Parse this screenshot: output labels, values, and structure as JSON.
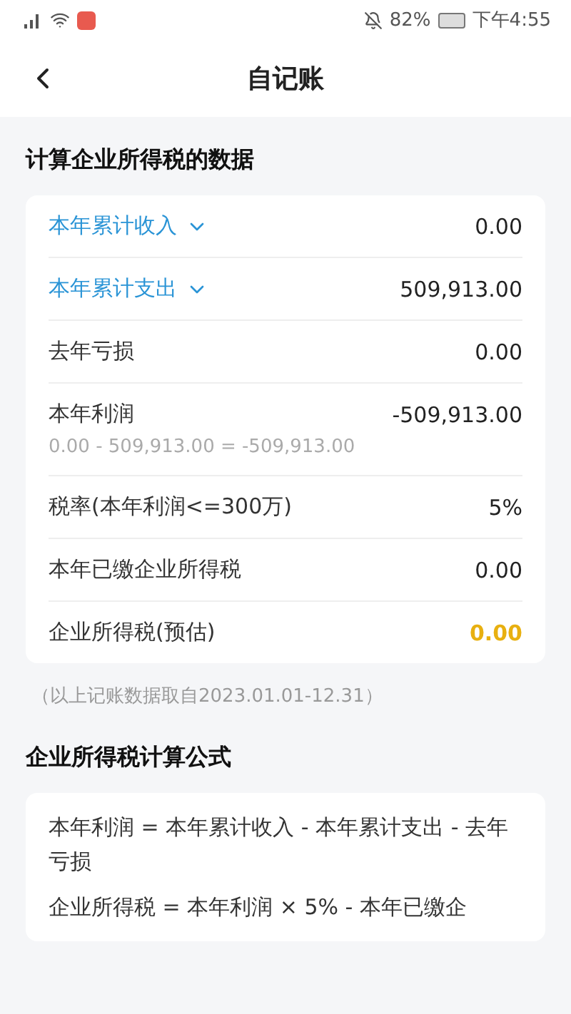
{
  "status_bar": {
    "battery": "82%",
    "time": "下午4:55"
  },
  "header": {
    "title": "自记账"
  },
  "data_section": {
    "title": "计算企业所得税的数据",
    "rows": [
      {
        "kind": "expandable",
        "label": "本年累计收入",
        "value": "0.00",
        "expanded": false
      },
      {
        "kind": "expandable",
        "label": "本年累计支出",
        "value": "509,913.00",
        "expanded": false
      },
      {
        "kind": "plain",
        "label": "去年亏损",
        "value": "0.00"
      },
      {
        "kind": "formula",
        "label": "本年利润",
        "value": "-509,913.00",
        "formula": "0.00 - 509,913.00 = -509,913.00"
      },
      {
        "kind": "plain",
        "label": "税率(本年利润<=300万)",
        "value": "5%"
      },
      {
        "kind": "plain",
        "label": "本年已缴企业所得税",
        "value": "0.00"
      },
      {
        "kind": "result",
        "label": "企业所得税(预估)",
        "value": "0.00"
      }
    ],
    "note": "（以上记账数据取自2023.01.01-12.31）"
  },
  "formula_section": {
    "title": "企业所得税计算公式",
    "lines": [
      "本年利润 = 本年累计收入 - 本年累计支出 - 去年亏损",
      "企业所得税 = 本年利润 × 5% - 本年已缴企"
    ]
  }
}
